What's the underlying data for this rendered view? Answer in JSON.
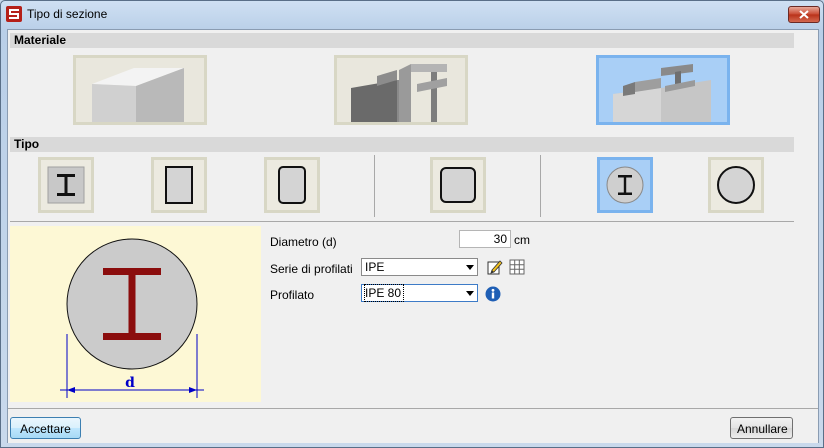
{
  "window": {
    "title": "Tipo di sezione"
  },
  "sections": {
    "materiale": "Materiale",
    "tipo": "Tipo"
  },
  "materiale": {
    "options": [
      {
        "name": "concrete",
        "selected": false
      },
      {
        "name": "steel",
        "selected": false
      },
      {
        "name": "composite",
        "selected": true
      }
    ]
  },
  "tipo": {
    "options": [
      {
        "name": "i-beam-embedded",
        "selected": false
      },
      {
        "name": "rectangle",
        "selected": false
      },
      {
        "name": "rounded-rectangle",
        "selected": false
      },
      {
        "name": "rounded-square",
        "selected": false
      },
      {
        "name": "i-beam-in-circle",
        "selected": true
      },
      {
        "name": "circle",
        "selected": false
      }
    ]
  },
  "form": {
    "diametro_label": "Diametro (d)",
    "diametro_value": "30",
    "diametro_unit": "cm",
    "serie_label": "Serie di profilati",
    "serie_value": "IPE",
    "profilato_label": "Profilato",
    "profilato_value": "IPE 80"
  },
  "preview": {
    "dimension_label": "d"
  },
  "buttons": {
    "accept": "Accettare",
    "cancel": "Annullare"
  },
  "colors": {
    "accent": "#7ab3ee",
    "steel_section": "#8b0d0d",
    "preview_bg": "#fdf8d5",
    "dimension_line": "#0000c8"
  }
}
